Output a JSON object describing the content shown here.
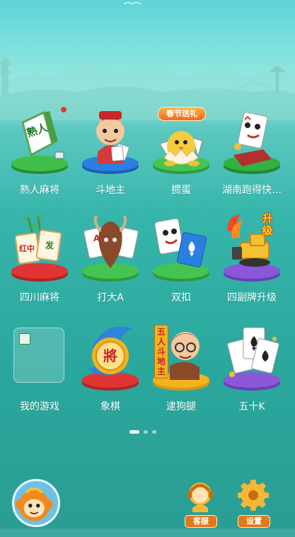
{
  "games": [
    {
      "label": "熟人麻将",
      "icon": "mahjong-tile-icon",
      "tile_text": "熟人"
    },
    {
      "label": "斗地主",
      "icon": "landlord-character-icon"
    },
    {
      "label": "掼蛋",
      "icon": "chick-egg-icon",
      "badge": "春节送礼"
    },
    {
      "label": "湖南跑得快…",
      "icon": "card-character-icon"
    },
    {
      "label": "四川麻将",
      "icon": "sichuan-mahjong-tiles-icon",
      "tile_texts": [
        "红中",
        "发"
      ]
    },
    {
      "label": "打大A",
      "icon": "ace-cards-bull-icon"
    },
    {
      "label": "双扣",
      "icon": "card-characters-icon"
    },
    {
      "label": "四副牌升级",
      "icon": "upgrade-bulldozer-icon",
      "badge": "升级"
    },
    {
      "label": "我的游戏",
      "icon": "my-games-icon"
    },
    {
      "label": "象棋",
      "icon": "chinese-chess-piece-icon",
      "piece_text": "將"
    },
    {
      "label": "逮狗腿",
      "icon": "five-player-landlord-icon",
      "banner": "五人斗地主"
    },
    {
      "label": "五十K",
      "icon": "playing-cards-icon"
    }
  ],
  "pagination": {
    "pages": 3,
    "current": 1
  },
  "bottom_bar": {
    "avatar_icon": "monkey-avatar-icon",
    "service_label": "客服",
    "settings_label": "设置"
  },
  "colors": {
    "accent_orange": "#e2791d",
    "platform_green": "#3fbf4a",
    "platform_blue": "#2a7fe0",
    "platform_red": "#e03535",
    "platform_purple": "#8a58d6",
    "platform_yellow": "#f2b31d",
    "platform_orange": "#f08a1e"
  }
}
